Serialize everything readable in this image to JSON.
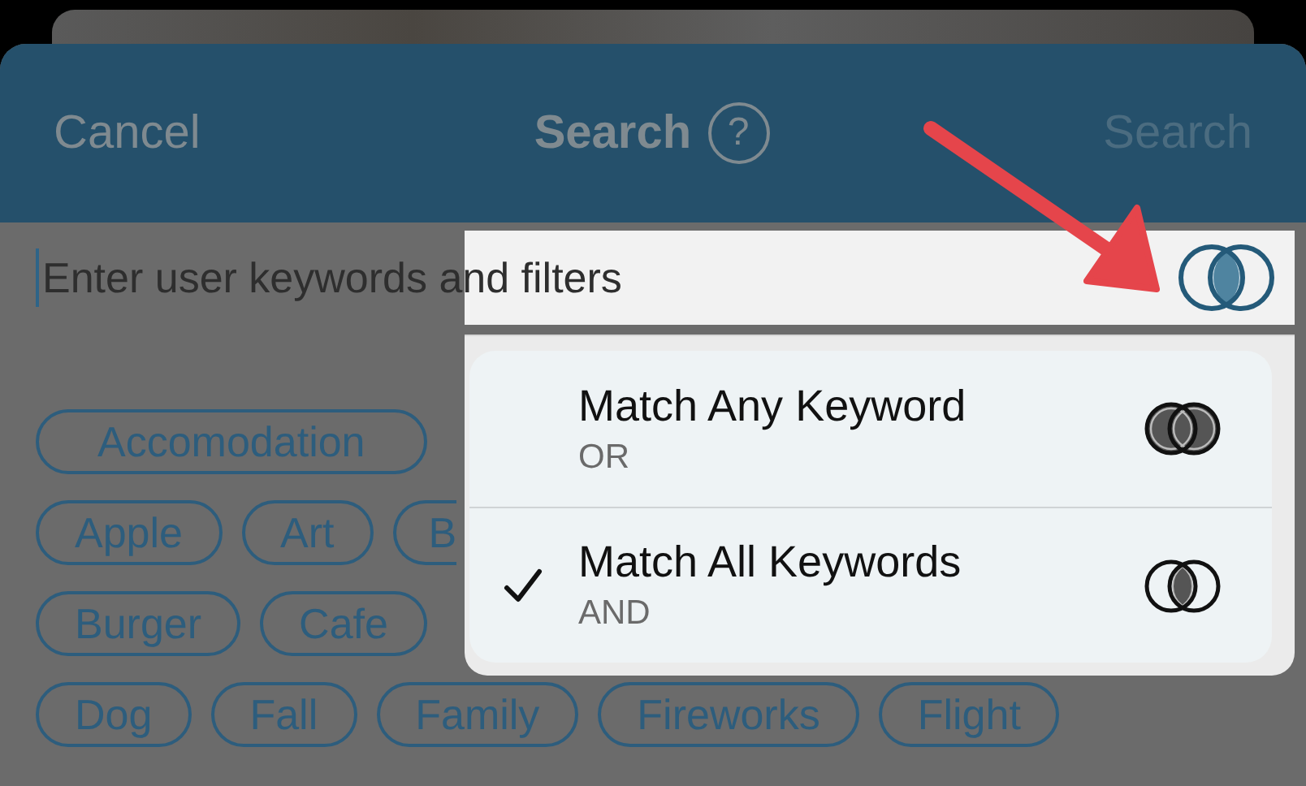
{
  "header": {
    "cancel": "Cancel",
    "title": "Search",
    "help": "?",
    "action": "Search"
  },
  "search_field": {
    "placeholder": "Enter user keywords and filters"
  },
  "tag_rows": [
    [
      "Accomodation"
    ],
    [
      "Apple",
      "Art",
      "B"
    ],
    [
      "Burger",
      "Cafe"
    ],
    [
      "Dog",
      "Fall",
      "Family",
      "Fireworks",
      "Flight"
    ]
  ],
  "match_menu": [
    {
      "label": "Match Any Keyword",
      "sublabel": "OR",
      "kind": "union",
      "selected": false
    },
    {
      "label": "Match All Keywords",
      "sublabel": "AND",
      "kind": "intersection",
      "selected": true
    }
  ]
}
